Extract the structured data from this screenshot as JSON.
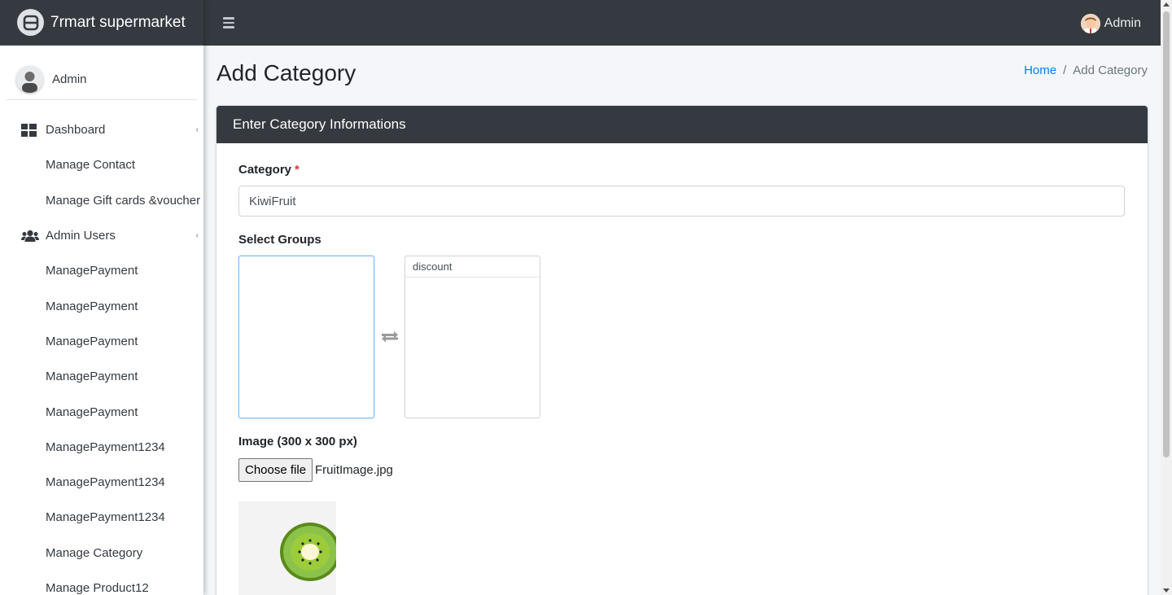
{
  "brand": {
    "name": "7rmart supermarket"
  },
  "sidebar": {
    "user_name": "Admin",
    "items": [
      {
        "label": "Dashboard",
        "icon": "dashboard-icon",
        "has_caret": true
      },
      {
        "label": "Manage Contact"
      },
      {
        "label": "Manage Gift cards &voucher"
      },
      {
        "label": "Admin Users",
        "icon": "users-icon",
        "has_caret": true
      },
      {
        "label": "ManagePayment"
      },
      {
        "label": "ManagePayment"
      },
      {
        "label": "ManagePayment"
      },
      {
        "label": "ManagePayment"
      },
      {
        "label": "ManagePayment"
      },
      {
        "label": "ManagePayment1234"
      },
      {
        "label": "ManagePayment1234"
      },
      {
        "label": "ManagePayment1234"
      },
      {
        "label": "Manage Category"
      },
      {
        "label": "Manage Product12"
      }
    ]
  },
  "topbar": {
    "user_name": "Admin"
  },
  "page": {
    "title": "Add Category",
    "breadcrumb": {
      "home": "Home",
      "separator": "/",
      "current": "Add Category"
    }
  },
  "form": {
    "header": "Enter Category Informations",
    "category_label": "Category",
    "required_mark": "*",
    "category_value": "KiwiFruit",
    "groups_label": "Select Groups",
    "available_groups": [],
    "selected_groups": [
      "discount"
    ],
    "image_label": "Image (300 x 300 px)",
    "choose_file_label": "Choose file",
    "file_name": "FruitImage.jpg"
  },
  "colors": {
    "dark": "#343a40",
    "link": "#007bff",
    "required": "#dc3545",
    "page_bg": "#f4f6f9"
  }
}
